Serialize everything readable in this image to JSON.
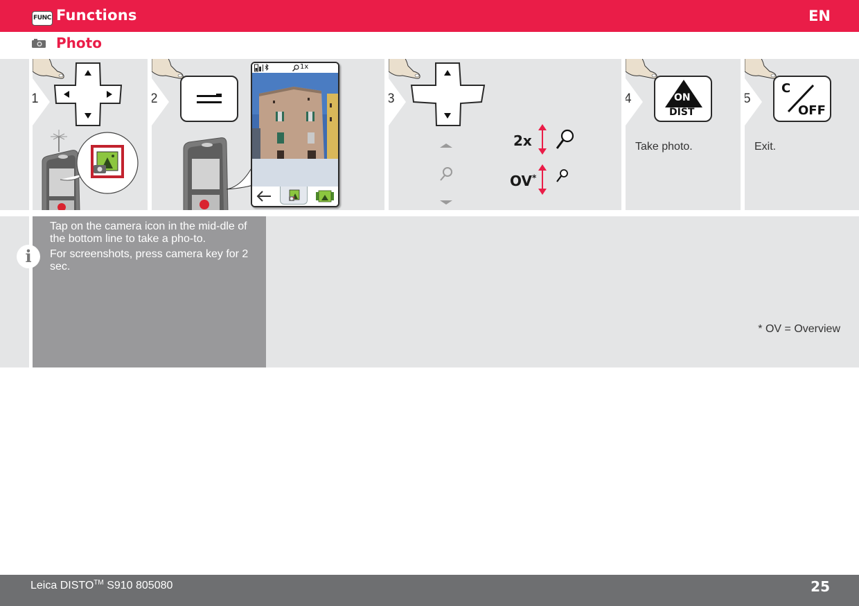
{
  "header": {
    "badge": "FUNC",
    "title": "Functions",
    "language": "EN",
    "accent_color": "#ea1d48"
  },
  "section": {
    "icon": "camera-icon",
    "title": "Photo"
  },
  "steps": [
    {
      "number": "1",
      "key": "dpad-4way",
      "icon": "finger-press-icon",
      "illustration": "device-with-camera-app-icon"
    },
    {
      "number": "2",
      "key": "menu-key",
      "icon": "finger-press-icon",
      "screen": {
        "status_zoom": "1x",
        "status_icons": [
          "battery-icon",
          "bluetooth-icon",
          "magnifier-icon"
        ],
        "bottom_bar": [
          "back-arrow-icon",
          "camera-capture-icon",
          "gallery-icon"
        ]
      }
    },
    {
      "number": "3",
      "key": "dpad-up-down",
      "icon": "finger-press-icon",
      "zoom_in_label": "2x",
      "zoom_out_label": "OV",
      "zoom_out_mark": "*"
    },
    {
      "number": "4",
      "key": "on-dist-key",
      "key_label_top": "ON",
      "key_label_bottom": "DIST",
      "text": "Take photo."
    },
    {
      "number": "5",
      "key": "clear-off-key",
      "key_label_top": "C",
      "key_label_bottom": "OFF",
      "text": "Exit."
    }
  ],
  "info": {
    "icon": "i",
    "paragraphs": [
      "Tap on the  camera icon in the mid-dle of the bottom line to take a pho-to.",
      "For screenshots, press camera key for 2 sec."
    ],
    "footnote": "* OV = Overview"
  },
  "footer": {
    "product": "Leica DISTO",
    "trademark": "TM",
    "model": " S910 805080",
    "page": "25"
  }
}
